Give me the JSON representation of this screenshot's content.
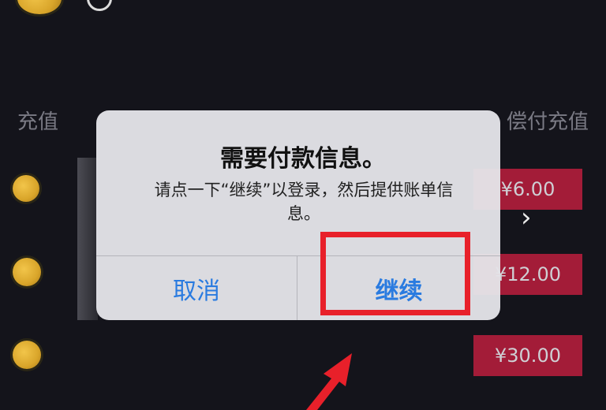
{
  "background": {
    "labels": {
      "left": "充值",
      "right": "偿付充值"
    },
    "prices": [
      "¥6.00",
      "¥12.00",
      "¥30.00"
    ]
  },
  "dialog": {
    "title": "需要付款信息。",
    "message": "请点一下“继续”以登录，然后提供账单信息。",
    "cancel_label": "取消",
    "continue_label": "继续"
  },
  "colors": {
    "background": "#14141b",
    "price_tag": "#a31c38",
    "dialog_button": "#2a7be0",
    "highlight": "#e8202a"
  },
  "icons": [
    "coin-icon",
    "chevron-right-icon",
    "arrow-up-right-icon"
  ]
}
